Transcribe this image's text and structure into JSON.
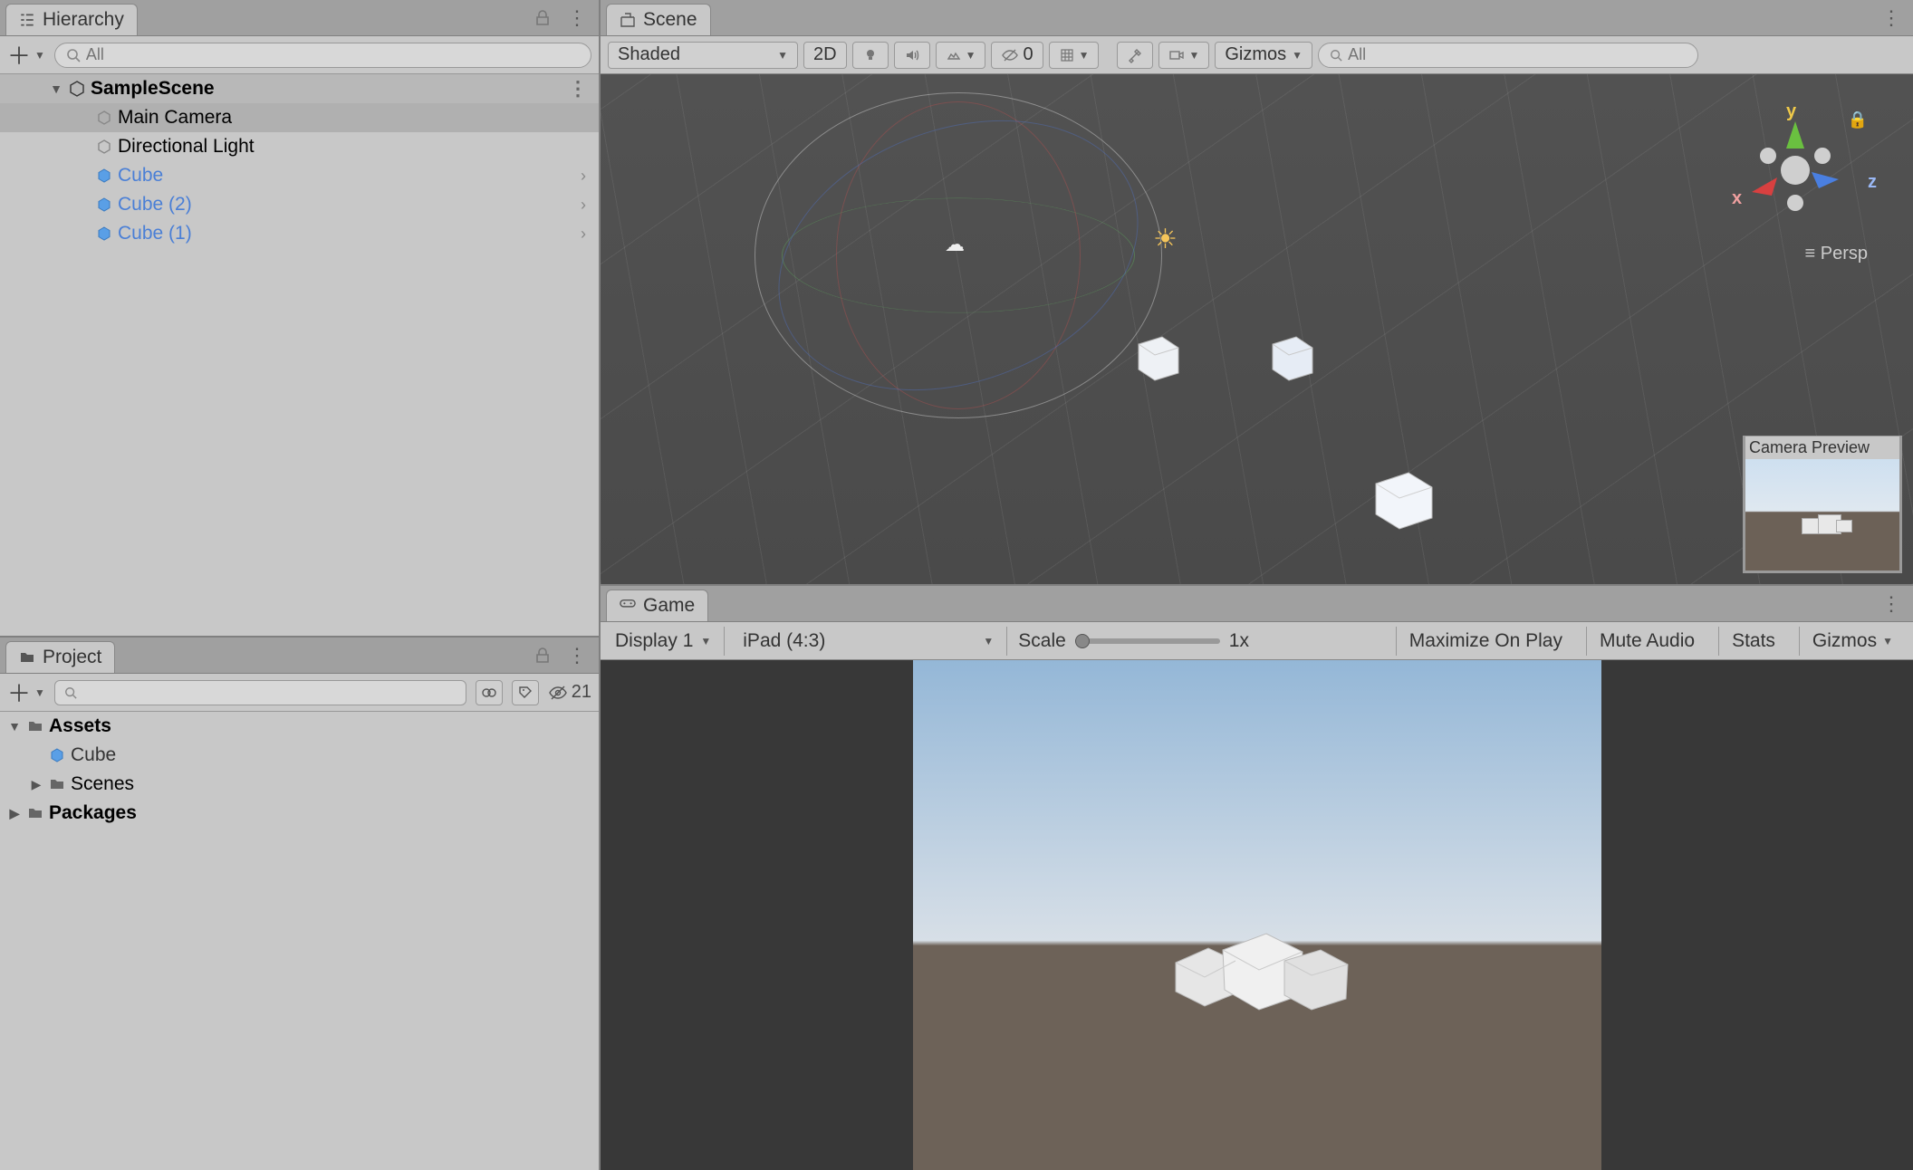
{
  "hierarchy": {
    "tab_label": "Hierarchy",
    "search_placeholder": "All",
    "scene_name": "SampleScene",
    "items": [
      {
        "label": "Main Camera",
        "selected": true,
        "blue": false,
        "icon": "camera",
        "expand": false
      },
      {
        "label": "Directional Light",
        "selected": false,
        "blue": false,
        "icon": "light",
        "expand": false
      },
      {
        "label": "Cube",
        "selected": false,
        "blue": true,
        "icon": "prefab",
        "expand": true
      },
      {
        "label": "Cube (2)",
        "selected": false,
        "blue": true,
        "icon": "prefab",
        "expand": true
      },
      {
        "label": "Cube (1)",
        "selected": false,
        "blue": true,
        "icon": "prefab",
        "expand": true
      }
    ]
  },
  "project": {
    "tab_label": "Project",
    "search_placeholder": "",
    "hidden_count": "21",
    "tree": {
      "assets": "Assets",
      "cube": "Cube",
      "scenes": "Scenes",
      "packages": "Packages"
    }
  },
  "scene": {
    "tab_label": "Scene",
    "shading_mode": "Shaded",
    "toggle_2d": "2D",
    "layers_count": "0",
    "gizmos_label": "Gizmos",
    "search_placeholder": "All",
    "axis_labels": {
      "x": "x",
      "y": "y",
      "z": "z"
    },
    "projection_label": "Persp",
    "camera_preview_label": "Camera Preview"
  },
  "game": {
    "tab_label": "Game",
    "display_label": "Display 1",
    "aspect_label": "iPad (4:3)",
    "scale_label": "Scale",
    "scale_value": "1x",
    "maximize_label": "Maximize On Play",
    "mute_label": "Mute Audio",
    "stats_label": "Stats",
    "gizmos_label": "Gizmos"
  }
}
